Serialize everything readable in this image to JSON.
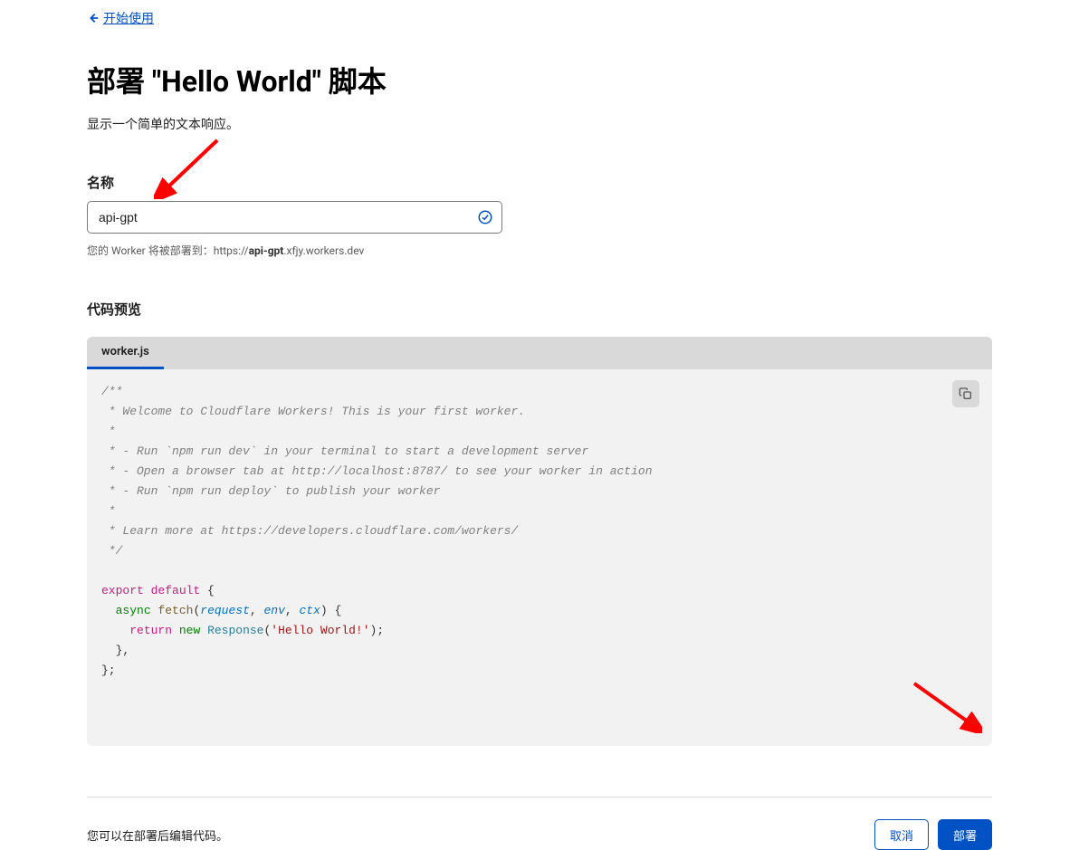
{
  "back_link": "开始使用",
  "page_title": "部署 \"Hello World\" 脚本",
  "subtitle": "显示一个简单的文本响应。",
  "name_section": {
    "label": "名称",
    "value": "api-gpt",
    "hint_prefix": "您的 Worker 将被部署到：https://",
    "hint_bold": "api-gpt",
    "hint_suffix": ".xfjy.workers.dev"
  },
  "code_section": {
    "title": "代码预览",
    "tab": "worker.js",
    "comment_lines": [
      "/**",
      " * Welcome to Cloudflare Workers! This is your first worker.",
      " *",
      " * - Run `npm run dev` in your terminal to start a development server",
      " * - Open a browser tab at http://localhost:8787/ to see your worker in action",
      " * - Run `npm run deploy` to publish your worker",
      " *",
      " * Learn more at https://developers.cloudflare.com/workers/",
      " */"
    ],
    "code": {
      "export": "export",
      "default": "default",
      "async": "async",
      "fetch": "fetch",
      "request": "request",
      "env": "env",
      "ctx": "ctx",
      "return": "return",
      "new": "new",
      "Response": "Response",
      "string": "'Hello World!'"
    }
  },
  "footer": {
    "hint": "您可以在部署后编辑代码。",
    "cancel": "取消",
    "deploy": "部署"
  }
}
